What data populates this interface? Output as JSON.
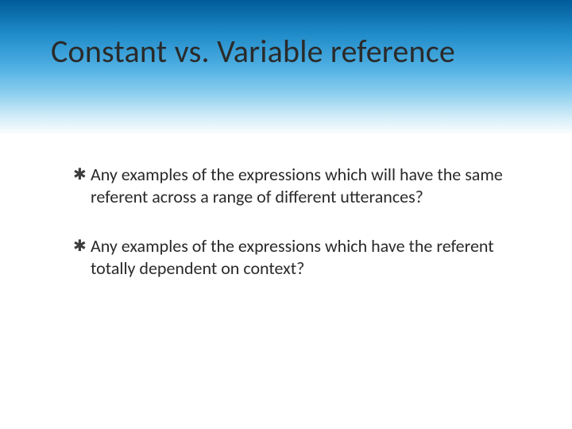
{
  "slide": {
    "title": "Constant vs. Variable reference",
    "bullets": [
      {
        "text": "Any examples of the expressions which will have the same referent across a range of different utterances?"
      },
      {
        "text": "Any examples of the expressions which have the referent totally dependent on context?"
      }
    ]
  },
  "style": {
    "bullet_glyph": "✱"
  }
}
